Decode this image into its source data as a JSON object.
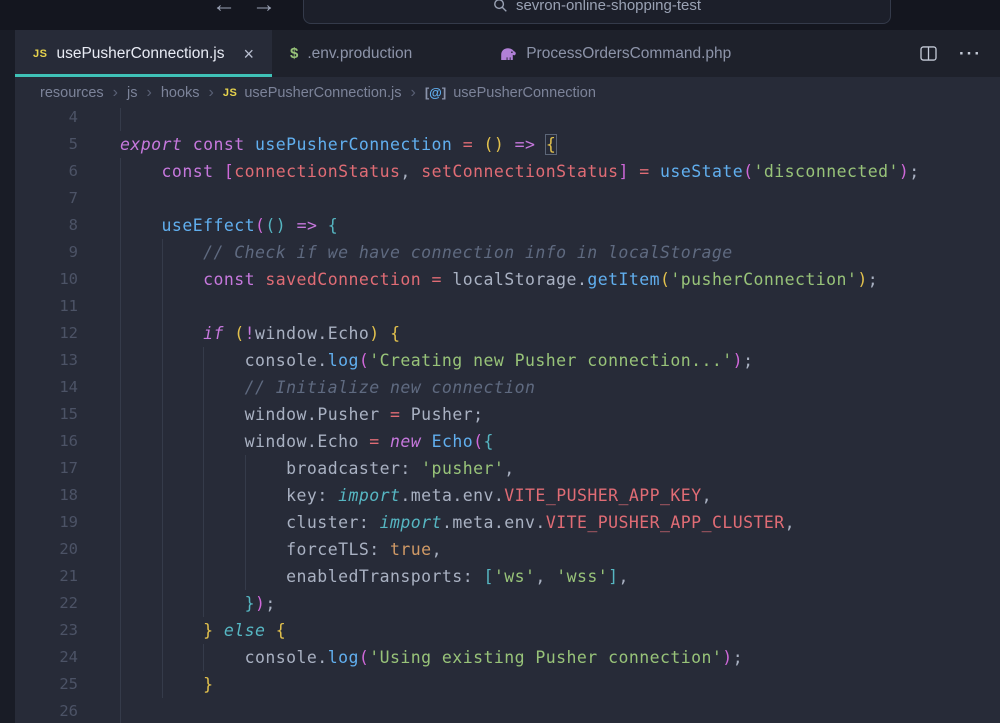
{
  "colors": {
    "editor_bg": "#272b38",
    "topbar_bg": "#14161f",
    "tabstrip_bg": "#1e212b",
    "active_tab_accent": "#3fc2b7",
    "keyword": "#c678dd",
    "function": "#61afef",
    "variable": "#e06c75",
    "string": "#98c379",
    "comment": "#5f6a80",
    "boolean": "#d19a66",
    "plain": "#a9b1c2",
    "bracket_gold": "#e2c14d",
    "bracket_purple": "#cf68d9",
    "bracket_cyan": "#56b6c2"
  },
  "top_bar": {
    "back_icon": "←",
    "forward_icon": "→",
    "search_icon": "magnifier",
    "search_query": "sevron-online-shopping-test"
  },
  "tab_bar": {
    "tabs": [
      {
        "icon": "js-icon",
        "icon_text": "JS",
        "label": "usePusherConnection.js",
        "active": true,
        "close_label": "×"
      },
      {
        "icon": "env-dollar-icon",
        "icon_text": "$",
        "label": ".env.production",
        "active": false
      },
      {
        "icon": "php-elephant-icon",
        "label": "ProcessOrdersCommand.php",
        "active": false,
        "gap_before": true
      }
    ],
    "split_editor_icon": "split-editor",
    "more_actions_icon": "···"
  },
  "breadcrumb": {
    "separator": "›",
    "items": [
      {
        "label": "resources"
      },
      {
        "label": "js"
      },
      {
        "label": "hooks"
      },
      {
        "label": "usePusherConnection.js",
        "icon": "js-icon",
        "icon_text": "JS"
      },
      {
        "label": "usePusherConnection",
        "icon": "symbol-icon",
        "icon_text": "[@]"
      }
    ]
  },
  "editor": {
    "lines": [
      {
        "n": 4,
        "g": 1,
        "t": []
      },
      {
        "n": 5,
        "g": 0,
        "t": [
          [
            "export",
            "kwi"
          ],
          [
            " ",
            "pl"
          ],
          [
            "const",
            "kw"
          ],
          [
            " ",
            "pl"
          ],
          [
            "usePusherConnection",
            "fn"
          ],
          [
            " ",
            "pl"
          ],
          [
            "=",
            "op"
          ],
          [
            " ",
            "pl"
          ],
          [
            "()",
            "b1"
          ],
          [
            " ",
            "pl"
          ],
          [
            "=>",
            "kw"
          ],
          [
            " ",
            "pl"
          ],
          [
            "{",
            "bm"
          ]
        ]
      },
      {
        "n": 6,
        "g": 1,
        "t": [
          [
            "    ",
            "pl"
          ],
          [
            "const",
            "kw"
          ],
          [
            " ",
            "pl"
          ],
          [
            "[",
            "b2"
          ],
          [
            "connectionStatus",
            "vr"
          ],
          [
            ", ",
            "pl"
          ],
          [
            "setConnectionStatus",
            "vr"
          ],
          [
            "]",
            "b2"
          ],
          [
            " ",
            "pl"
          ],
          [
            "=",
            "op"
          ],
          [
            " ",
            "pl"
          ],
          [
            "useState",
            "fn"
          ],
          [
            "(",
            "b2"
          ],
          [
            "'disconnected'",
            "st"
          ],
          [
            ")",
            "b2"
          ],
          [
            ";",
            "pl"
          ]
        ]
      },
      {
        "n": 7,
        "g": 1,
        "t": []
      },
      {
        "n": 8,
        "g": 1,
        "t": [
          [
            "    ",
            "pl"
          ],
          [
            "useEffect",
            "fn"
          ],
          [
            "(",
            "b2"
          ],
          [
            "()",
            "b3"
          ],
          [
            " ",
            "pl"
          ],
          [
            "=>",
            "kw"
          ],
          [
            " ",
            "pl"
          ],
          [
            "{",
            "b3"
          ]
        ]
      },
      {
        "n": 9,
        "g": 2,
        "t": [
          [
            "        ",
            "pl"
          ],
          [
            "// Check if we have connection info in localStorage",
            "cm"
          ]
        ]
      },
      {
        "n": 10,
        "g": 2,
        "t": [
          [
            "        ",
            "pl"
          ],
          [
            "const",
            "kw"
          ],
          [
            " ",
            "pl"
          ],
          [
            "savedConnection",
            "vr"
          ],
          [
            " ",
            "pl"
          ],
          [
            "=",
            "op"
          ],
          [
            " ",
            "pl"
          ],
          [
            "localStorage",
            "pl"
          ],
          [
            ".",
            "pl"
          ],
          [
            "getItem",
            "fn"
          ],
          [
            "(",
            "b1"
          ],
          [
            "'pusherConnection'",
            "st"
          ],
          [
            ")",
            "b1"
          ],
          [
            ";",
            "pl"
          ]
        ]
      },
      {
        "n": 11,
        "g": 2,
        "t": []
      },
      {
        "n": 12,
        "g": 2,
        "t": [
          [
            "        ",
            "pl"
          ],
          [
            "if",
            "kwi"
          ],
          [
            " ",
            "pl"
          ],
          [
            "(",
            "b1"
          ],
          [
            "!",
            "kw"
          ],
          [
            "window",
            "pl"
          ],
          [
            ".",
            "pl"
          ],
          [
            "Echo",
            "pl"
          ],
          [
            ")",
            "b1"
          ],
          [
            " ",
            "pl"
          ],
          [
            "{",
            "b1"
          ]
        ]
      },
      {
        "n": 13,
        "g": 3,
        "t": [
          [
            "            ",
            "pl"
          ],
          [
            "console",
            "pl"
          ],
          [
            ".",
            "pl"
          ],
          [
            "log",
            "fn"
          ],
          [
            "(",
            "b2"
          ],
          [
            "'Creating new Pusher connection...'",
            "st"
          ],
          [
            ")",
            "b2"
          ],
          [
            ";",
            "pl"
          ]
        ]
      },
      {
        "n": 14,
        "g": 3,
        "t": [
          [
            "            ",
            "pl"
          ],
          [
            "// Initialize new connection",
            "cm"
          ]
        ]
      },
      {
        "n": 15,
        "g": 3,
        "t": [
          [
            "            ",
            "pl"
          ],
          [
            "window",
            "pl"
          ],
          [
            ".",
            "pl"
          ],
          [
            "Pusher",
            "pl"
          ],
          [
            " ",
            "pl"
          ],
          [
            "=",
            "op"
          ],
          [
            " ",
            "pl"
          ],
          [
            "Pusher",
            "pl"
          ],
          [
            ";",
            "pl"
          ]
        ]
      },
      {
        "n": 16,
        "g": 3,
        "t": [
          [
            "            ",
            "pl"
          ],
          [
            "window",
            "pl"
          ],
          [
            ".",
            "pl"
          ],
          [
            "Echo",
            "pl"
          ],
          [
            " ",
            "pl"
          ],
          [
            "=",
            "op"
          ],
          [
            " ",
            "pl"
          ],
          [
            "new",
            "kwi"
          ],
          [
            " ",
            "pl"
          ],
          [
            "Echo",
            "fn"
          ],
          [
            "(",
            "b2"
          ],
          [
            "{",
            "b3"
          ]
        ]
      },
      {
        "n": 17,
        "g": 4,
        "t": [
          [
            "                ",
            "pl"
          ],
          [
            "broadcaster",
            "pl"
          ],
          [
            ":",
            "pl"
          ],
          [
            " ",
            "pl"
          ],
          [
            "'pusher'",
            "st"
          ],
          [
            ",",
            "pl"
          ]
        ]
      },
      {
        "n": 18,
        "g": 4,
        "t": [
          [
            "                ",
            "pl"
          ],
          [
            "key",
            "pl"
          ],
          [
            ":",
            "pl"
          ],
          [
            " ",
            "pl"
          ],
          [
            "import",
            "cyi"
          ],
          [
            ".",
            "pl"
          ],
          [
            "meta",
            "pl"
          ],
          [
            ".",
            "pl"
          ],
          [
            "env",
            "pl"
          ],
          [
            ".",
            "pl"
          ],
          [
            "VITE_PUSHER_APP_KEY",
            "vr"
          ],
          [
            ",",
            "pl"
          ]
        ]
      },
      {
        "n": 19,
        "g": 4,
        "t": [
          [
            "                ",
            "pl"
          ],
          [
            "cluster",
            "pl"
          ],
          [
            ":",
            "pl"
          ],
          [
            " ",
            "pl"
          ],
          [
            "import",
            "cyi"
          ],
          [
            ".",
            "pl"
          ],
          [
            "meta",
            "pl"
          ],
          [
            ".",
            "pl"
          ],
          [
            "env",
            "pl"
          ],
          [
            ".",
            "pl"
          ],
          [
            "VITE_PUSHER_APP_CLUSTER",
            "vr"
          ],
          [
            ",",
            "pl"
          ]
        ]
      },
      {
        "n": 20,
        "g": 4,
        "t": [
          [
            "                ",
            "pl"
          ],
          [
            "forceTLS",
            "pl"
          ],
          [
            ":",
            "pl"
          ],
          [
            " ",
            "pl"
          ],
          [
            "true",
            "nm"
          ],
          [
            ",",
            "pl"
          ]
        ]
      },
      {
        "n": 21,
        "g": 4,
        "t": [
          [
            "                ",
            "pl"
          ],
          [
            "enabledTransports",
            "pl"
          ],
          [
            ":",
            "pl"
          ],
          [
            " ",
            "pl"
          ],
          [
            "[",
            "b3"
          ],
          [
            "'ws'",
            "st"
          ],
          [
            ",",
            "pl"
          ],
          [
            " ",
            "pl"
          ],
          [
            "'wss'",
            "st"
          ],
          [
            "]",
            "b3"
          ],
          [
            ",",
            "pl"
          ]
        ]
      },
      {
        "n": 22,
        "g": 3,
        "t": [
          [
            "            ",
            "pl"
          ],
          [
            "}",
            "b3"
          ],
          [
            ")",
            "b2"
          ],
          [
            ";",
            "pl"
          ]
        ]
      },
      {
        "n": 23,
        "g": 2,
        "t": [
          [
            "        ",
            "pl"
          ],
          [
            "}",
            "b1"
          ],
          [
            " ",
            "pl"
          ],
          [
            "else",
            "cyi"
          ],
          [
            " ",
            "pl"
          ],
          [
            "{",
            "b1"
          ]
        ]
      },
      {
        "n": 24,
        "g": 3,
        "t": [
          [
            "            ",
            "pl"
          ],
          [
            "console",
            "pl"
          ],
          [
            ".",
            "pl"
          ],
          [
            "log",
            "fn"
          ],
          [
            "(",
            "b2"
          ],
          [
            "'Using existing Pusher connection'",
            "st"
          ],
          [
            ")",
            "b2"
          ],
          [
            ";",
            "pl"
          ]
        ]
      },
      {
        "n": 25,
        "g": 2,
        "t": [
          [
            "        ",
            "pl"
          ],
          [
            "}",
            "b1"
          ]
        ]
      },
      {
        "n": 26,
        "g": 1,
        "t": []
      }
    ]
  }
}
